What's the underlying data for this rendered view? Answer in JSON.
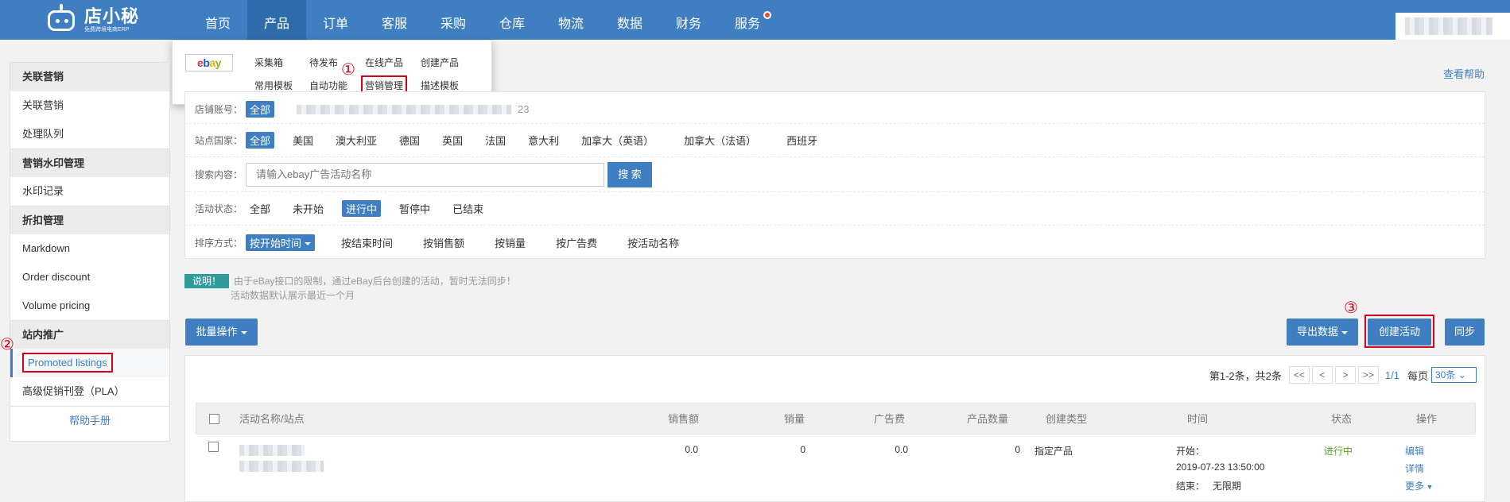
{
  "logo": {
    "name": "店小秘",
    "subtitle": "免费跨境电商ERP"
  },
  "nav": [
    "首页",
    "产品",
    "订单",
    "客服",
    "采购",
    "仓库",
    "物流",
    "数据",
    "财务",
    "服务"
  ],
  "dropdown": {
    "row1": [
      "采集箱",
      "待发布",
      "在线产品",
      "创建产品"
    ],
    "row2": [
      "常用模板",
      "自动功能",
      "营销管理",
      "描述模板"
    ]
  },
  "annotations": {
    "step1": "①",
    "step2": "②",
    "step3": "③"
  },
  "sidebar": {
    "group1": {
      "title": "关联营销",
      "items": [
        "关联营销",
        "处理队列"
      ]
    },
    "group2": {
      "title": "营销水印管理",
      "items": [
        "水印记录"
      ]
    },
    "group3": {
      "title": "折扣管理",
      "items": [
        "Markdown",
        "Order discount",
        "Volume pricing"
      ]
    },
    "group4": {
      "title": "站内推广",
      "items": [
        "Promoted listings",
        "高级促销刊登（PLA）"
      ]
    },
    "help": "帮助手册"
  },
  "help_link": "查看帮助",
  "filters": {
    "account_label": "店铺账号：",
    "account_all": "全部",
    "account_tail": "23",
    "site_label": "站点国家：",
    "sites": [
      "全部",
      "美国",
      "澳大利亚",
      "德国",
      "英国",
      "法国",
      "意大利",
      "加拿大（英语）",
      "加拿大（法语）",
      "西班牙"
    ],
    "search_label": "搜索内容：",
    "search_placeholder": "请输入ebay广告活动名称",
    "search_button": "搜 索",
    "status_label": "活动状态：",
    "statuses": [
      "全部",
      "未开始",
      "进行中",
      "暂停中",
      "已结束"
    ],
    "sort_label": "排序方式：",
    "sorts": [
      "按开始时间",
      "按结束时间",
      "按销售额",
      "按销量",
      "按广告费",
      "按活动名称"
    ]
  },
  "notice": {
    "tag": "说明！",
    "line1": "由于eBay接口的限制，通过eBay后台创建的活动，暂时无法同步！",
    "line2": "活动数据默认展示最近一个月"
  },
  "toolbar": {
    "batch": "批量操作",
    "export": "导出数据",
    "create": "创建活动",
    "sync": "同步"
  },
  "pager": {
    "summary": "第1-2条，共2条",
    "first": "<<",
    "prev": "<",
    "next": ">",
    "last": ">>",
    "page": "1/1",
    "per_page_label": "每页",
    "per_page": "30条"
  },
  "table": {
    "headers": {
      "name": "活动名称/站点",
      "sales": "销售额",
      "qty": "销量",
      "ad_fee": "广告费",
      "products": "产品数量",
      "type": "创建类型",
      "time": "时间",
      "status": "状态",
      "actions": "操作"
    },
    "rows": [
      {
        "sales": "0.0",
        "qty": "0",
        "ad_fee": "0.0",
        "products": "0",
        "type": "指定产品",
        "start_label": "开始：",
        "start": "2019-07-23 13:50:00",
        "end_label": "结束：",
        "end": "无限期",
        "status": "进行中",
        "edit": "编辑",
        "detail": "详情",
        "more": "更多"
      }
    ]
  },
  "colors": {
    "primary": "#3f7fc1",
    "highlight": "#d0021b",
    "active_status": "#5aa320"
  }
}
